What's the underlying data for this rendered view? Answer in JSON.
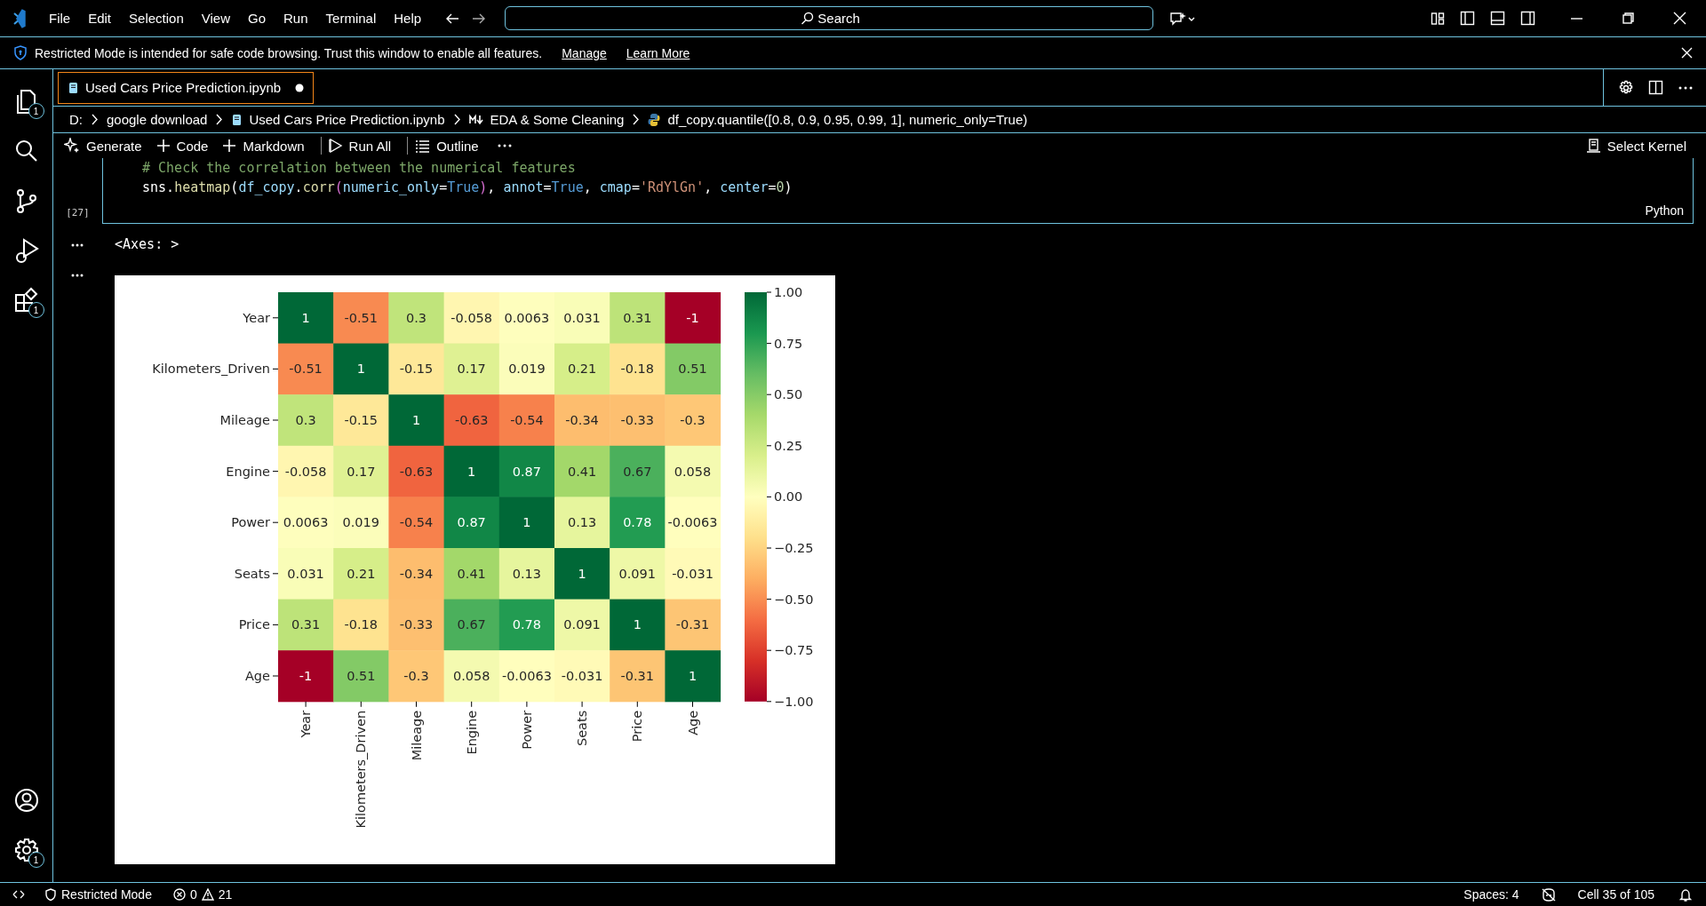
{
  "title_bar": {
    "menu": [
      "File",
      "Edit",
      "Selection",
      "View",
      "Go",
      "Run",
      "Terminal",
      "Help"
    ],
    "search": {
      "placeholder": "Search"
    }
  },
  "banner": {
    "message": "Restricted Mode is intended for safe code browsing. Trust this window to enable all features.",
    "links": [
      "Manage",
      "Learn More"
    ]
  },
  "activity_bar": {
    "top": [
      {
        "kind": "explorer",
        "badge": "1",
        "selected": false
      },
      {
        "kind": "search",
        "selected": false
      },
      {
        "kind": "source-control",
        "selected": false
      },
      {
        "kind": "run-debug",
        "selected": false
      },
      {
        "kind": "extensions",
        "badge": "1",
        "selected": false
      }
    ],
    "bottom": [
      {
        "kind": "account"
      },
      {
        "kind": "settings",
        "badge": "1"
      }
    ]
  },
  "tabs": [
    {
      "label": "Used Cars Price Prediction.ipynb",
      "selected": true,
      "dirty": true
    }
  ],
  "breadcrumb": [
    {
      "kind": "text",
      "label": "D:"
    },
    {
      "kind": "text",
      "label": "google download"
    },
    {
      "kind": "notebook",
      "label": "Used Cars Price Prediction.ipynb"
    },
    {
      "kind": "markdown",
      "label": "EDA & Some Cleaning"
    },
    {
      "kind": "python",
      "label": "df_copy.quantile([0.8, 0.9, 0.95, 0.99, 1], numeric_only=True)"
    }
  ],
  "toolbar": {
    "left": [
      {
        "kind": "generate",
        "label": "Generate"
      },
      {
        "kind": "add",
        "label": "Code"
      },
      {
        "kind": "add",
        "label": "Markdown"
      },
      {
        "kind": "separator"
      },
      {
        "kind": "run",
        "label": "Run All"
      },
      {
        "kind": "separator"
      },
      {
        "kind": "outline",
        "label": "Outline"
      },
      {
        "kind": "more"
      }
    ],
    "kernel": "Select Kernel"
  },
  "cell": {
    "execution_count": "[27]",
    "language": "Python",
    "lines": [
      [
        {
          "kind": "comment",
          "text": "# Check the correlation between the numerical features"
        }
      ],
      [
        {
          "kind": "plain",
          "text": "sns."
        },
        {
          "kind": "function",
          "text": "heatmap"
        },
        {
          "kind": "plain",
          "text": "("
        },
        {
          "kind": "variable",
          "text": "df_copy"
        },
        {
          "kind": "plain",
          "text": "."
        },
        {
          "kind": "function",
          "text": "corr"
        },
        {
          "kind": "bracket",
          "text": "("
        },
        {
          "kind": "param",
          "text": "numeric_only"
        },
        {
          "kind": "plain",
          "text": "="
        },
        {
          "kind": "keyword",
          "text": "True"
        },
        {
          "kind": "bracket",
          "text": ")"
        },
        {
          "kind": "plain",
          "text": ", "
        },
        {
          "kind": "param",
          "text": "annot"
        },
        {
          "kind": "plain",
          "text": "="
        },
        {
          "kind": "keyword",
          "text": "True"
        },
        {
          "kind": "plain",
          "text": ", "
        },
        {
          "kind": "param",
          "text": "cmap"
        },
        {
          "kind": "plain",
          "text": "="
        },
        {
          "kind": "string",
          "text": "'RdYlGn'"
        },
        {
          "kind": "plain",
          "text": ", "
        },
        {
          "kind": "param",
          "text": "center"
        },
        {
          "kind": "plain",
          "text": "="
        },
        {
          "kind": "number",
          "text": "0"
        },
        {
          "kind": "plain",
          "text": ")"
        }
      ]
    ]
  },
  "outputs": [
    {
      "kind": "text",
      "text": "<Axes: >"
    },
    {
      "kind": "heatmap",
      "heatmap": {
        "rows": [
          "Year",
          "Kilometers_Driven",
          "Mileage",
          "Engine",
          "Power",
          "Seats",
          "Price",
          "Age"
        ],
        "columns": [
          "Year",
          "Kilometers_Driven",
          "Mileage",
          "Engine",
          "Power",
          "Seats",
          "Price",
          "Age"
        ],
        "values": [
          [
            "1",
            "-0.51",
            "0.3",
            "-0.058",
            "0.0063",
            "0.031",
            "0.31",
            "-1"
          ],
          [
            "-0.51",
            "1",
            "-0.15",
            "0.17",
            "0.019",
            "0.21",
            "-0.18",
            "0.51"
          ],
          [
            "0.3",
            "-0.15",
            "1",
            "-0.63",
            "-0.54",
            "-0.34",
            "-0.33",
            "-0.3"
          ],
          [
            "-0.058",
            "0.17",
            "-0.63",
            "1",
            "0.87",
            "0.41",
            "0.67",
            "0.058"
          ],
          [
            "0.0063",
            "0.019",
            "-0.54",
            "0.87",
            "1",
            "0.13",
            "0.78",
            "-0.0063"
          ],
          [
            "0.031",
            "0.21",
            "-0.34",
            "0.41",
            "0.13",
            "1",
            "0.091",
            "-0.031"
          ],
          [
            "0.31",
            "-0.18",
            "-0.33",
            "0.67",
            "0.78",
            "0.091",
            "1",
            "-0.31"
          ],
          [
            "-1",
            "0.51",
            "-0.3",
            "0.058",
            "-0.0063",
            "-0.031",
            "-0.31",
            "1"
          ]
        ],
        "colorbar_ticks": [
          "1.00",
          "0.75",
          "0.50",
          "0.25",
          "0.00",
          "−0.25",
          "−0.50",
          "−0.75",
          "−1.00"
        ]
      }
    }
  ],
  "status_bar": {
    "mode": "Restricted Mode",
    "errors": "0",
    "warnings": "21",
    "spaces": "Spaces: 4",
    "cell_position": "Cell 35 of 105"
  }
}
